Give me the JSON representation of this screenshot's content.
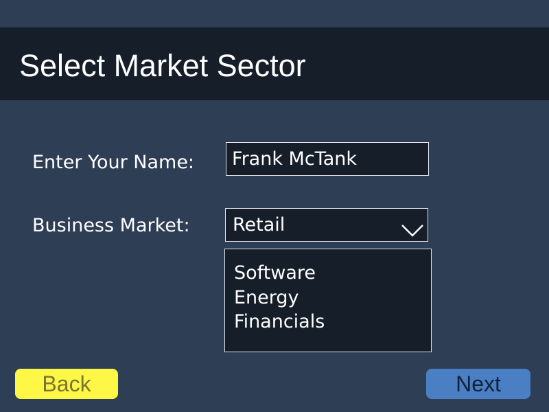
{
  "header": {
    "title": "Select Market Sector"
  },
  "form": {
    "name_label": "Enter Your Name:",
    "name_value": "Frank McTank",
    "market_label": "Business Market:",
    "market_selected": "Retail",
    "market_options": [
      "Software",
      "Energy",
      "Financials"
    ]
  },
  "buttons": {
    "back_label": "Back",
    "next_label": "Next"
  },
  "colors": {
    "background": "#2e3e55",
    "header_bg": "#161e2a",
    "field_bg": "#161e2a",
    "back_button": "#fff746",
    "next_button": "#4a7fc4"
  },
  "icons": {
    "dropdown": "chevron-down-icon"
  }
}
